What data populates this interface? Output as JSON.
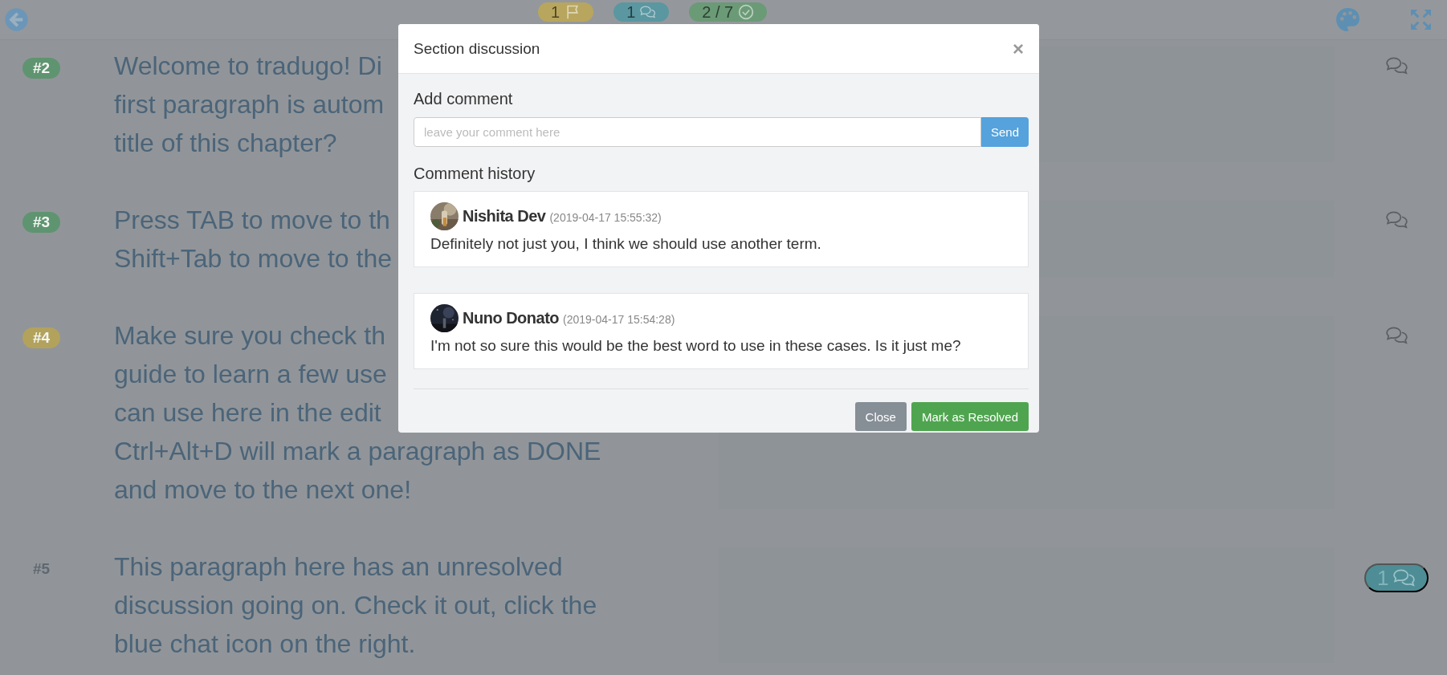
{
  "toolbar": {
    "badges": [
      {
        "kind": "flag",
        "count": "1",
        "color": "#b8a65e"
      },
      {
        "kind": "chat",
        "count": "1",
        "color": "#5a97a1"
      },
      {
        "kind": "check",
        "count": "2 / 7",
        "color": "#6b9a77"
      }
    ]
  },
  "paragraphs": [
    {
      "number": "#2",
      "color": "#5f9470",
      "lines": [
        "Welcome to tradugo! Di",
        "first paragraph is autom",
        "title of this chapter?"
      ]
    },
    {
      "number": "#3",
      "color": "#5f9470",
      "lines": [
        "Press TAB to move to th",
        "Shift+Tab to move to the"
      ]
    },
    {
      "number": "#4",
      "color": "#b3a25c",
      "lines": [
        "Make sure you check th",
        "guide to learn a few use",
        "can use here in the edit",
        "Ctrl+Alt+D will mark a paragraph as DONE",
        "and move to the next one!"
      ]
    },
    {
      "number": "#5",
      "lines": [
        "This paragraph here has an unresolved",
        "discussion going on. Check it out, click the",
        "blue chat icon on the right."
      ],
      "comments": "1"
    }
  ],
  "modal": {
    "title": "Section discussion",
    "close": "×",
    "add_label": "Add comment",
    "input": {
      "placeholder": "leave your comment here"
    },
    "send": "Send",
    "history_label": "Comment history",
    "comments": [
      {
        "author": "Nishita Dev",
        "time": "(2019-04-17 15:55:32)",
        "text": "Definitely not just you, I think we should use another term."
      },
      {
        "author": "Nuno Donato",
        "time": "(2019-04-17 15:54:28)",
        "text": "I'm not so sure this would be the best word to use in these cases. Is it just me?"
      }
    ],
    "buttons": [
      {
        "label": "Close",
        "kind": "secondary"
      },
      {
        "label": "Mark as Resolved",
        "kind": "success"
      }
    ]
  }
}
